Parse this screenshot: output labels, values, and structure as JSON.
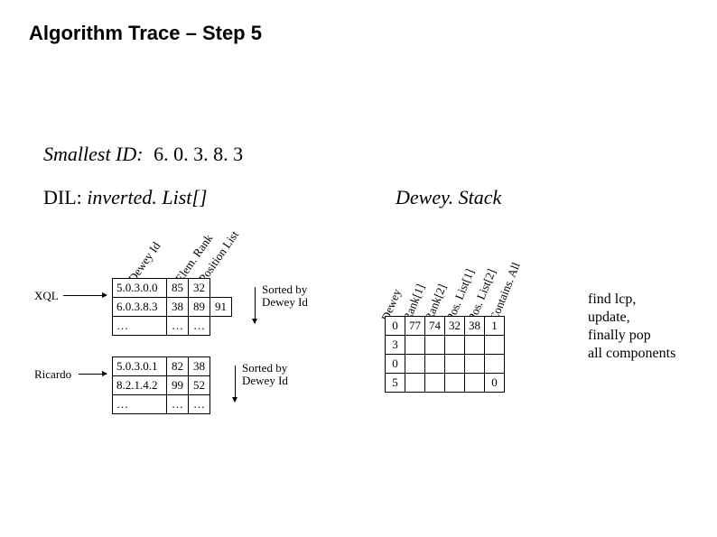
{
  "title": "Algorithm Trace – Step 5",
  "smallest_id": {
    "label": "Smallest ID:",
    "value": "6. 0. 3. 8. 3"
  },
  "dil": {
    "prefix": "DIL:",
    "rest": "inverted. List[]"
  },
  "dewey_stack_label": "Dewey. Stack",
  "dil_headers": {
    "h1": "Dewey Id",
    "h2": "Elem. Rank",
    "h3": "Position List"
  },
  "dil_rows": {
    "xql": "XQL",
    "ricardo": "Ricardo",
    "sorted_by": "Sorted by",
    "sorted_key": "Dewey Id"
  },
  "dil_data": {
    "xql": [
      {
        "dewey": "5.0.3.0.0",
        "rank": "85",
        "pos": "32",
        "extra": ""
      },
      {
        "dewey": "6.0.3.8.3",
        "rank": "38",
        "pos": "89",
        "extra": "91"
      },
      {
        "dewey": "…",
        "rank": "…",
        "pos": "…",
        "extra": ""
      }
    ],
    "ricardo": [
      {
        "dewey": "5.0.3.0.1",
        "rank": "82",
        "pos": "38",
        "extra": ""
      },
      {
        "dewey": "8.2.1.4.2",
        "rank": "99",
        "pos": "52",
        "extra": ""
      },
      {
        "dewey": "…",
        "rank": "…",
        "pos": "…",
        "extra": ""
      }
    ]
  },
  "ds_headers": {
    "h1": "Dewey",
    "h2": "Rank[1]",
    "h3": "Rank[2]",
    "h4": "Pos. List[1]",
    "h5": "Pos. List[2]",
    "h6": "Contains. All"
  },
  "ds_rows": [
    {
      "c1": "0",
      "c2": "77",
      "c3": "74",
      "c4": "32",
      "c5": "38",
      "c6": "1"
    },
    {
      "c1": "3",
      "c2": "",
      "c3": "",
      "c4": "",
      "c5": "",
      "c6": ""
    },
    {
      "c1": "0",
      "c2": "",
      "c3": "",
      "c4": "",
      "c5": "",
      "c6": ""
    },
    {
      "c1": "5",
      "c2": "",
      "c3": "",
      "c4": "",
      "c5": "",
      "c6": "0"
    }
  ],
  "note": {
    "l1": "find lcp,",
    "l2": "update,",
    "l3": "finally pop",
    "l4": "all components"
  }
}
